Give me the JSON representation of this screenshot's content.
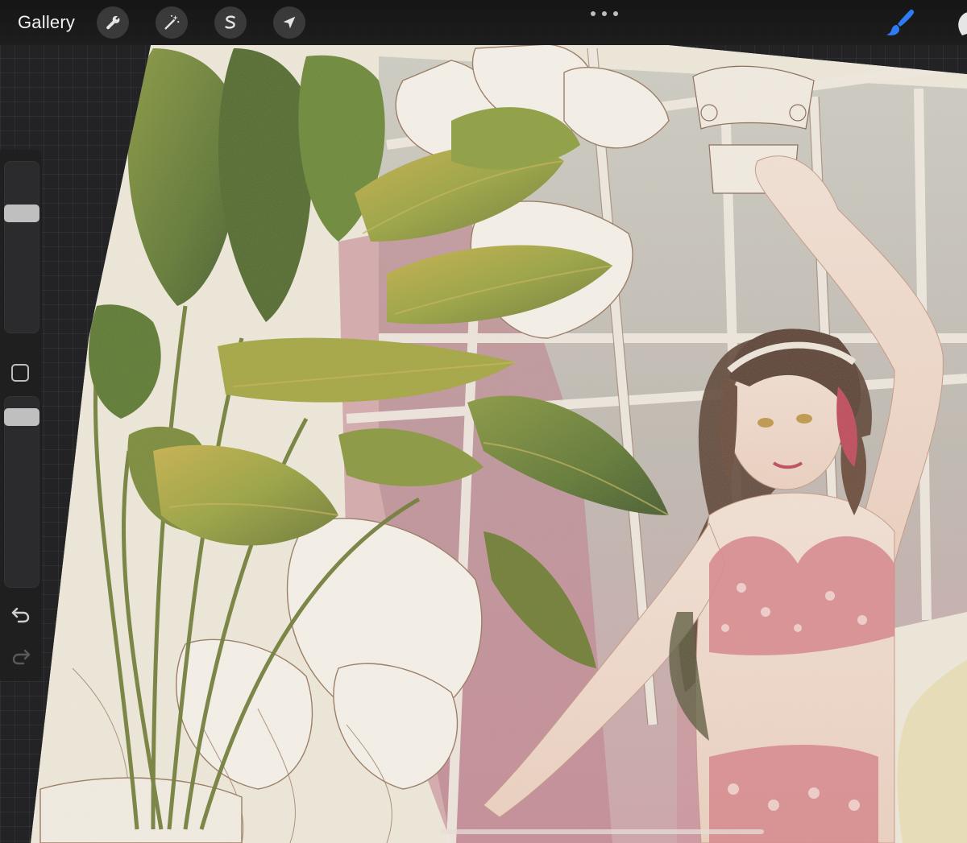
{
  "toolbar": {
    "gallery_label": "Gallery",
    "actions_icon": "wrench-icon",
    "adjustments_icon": "magic-wand-icon",
    "selection_icon": "selection-s-icon",
    "transform_icon": "arrow-cursor-icon",
    "more_icon": "more-dots-icon",
    "brush_icon": "brush-icon",
    "smudge_icon": "smudge-finger-icon",
    "brush_color": "#2f7bf5"
  },
  "sidebar": {
    "brush_size_fraction": 0.72,
    "opacity_fraction": 0.93,
    "modify_icon": "square-modify-icon",
    "undo_icon": "undo-icon",
    "redo_icon": "redo-icon"
  },
  "canvas": {
    "artwork": "watercolor-illustration"
  }
}
